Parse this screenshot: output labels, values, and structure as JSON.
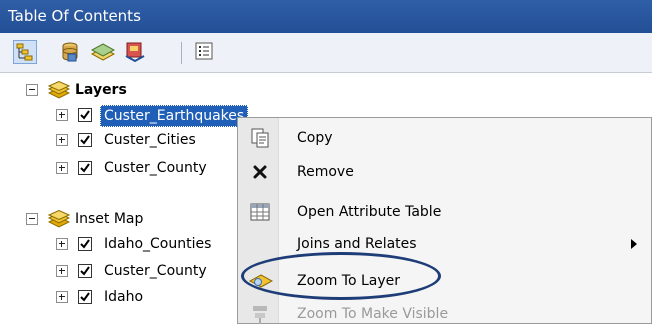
{
  "window": {
    "title": "Table Of Contents"
  },
  "toolbar": {
    "buttons": [
      {
        "icon": "list-by-drawing-order-icon"
      },
      {
        "icon": "list-by-source-icon"
      },
      {
        "icon": "list-by-visibility-icon"
      },
      {
        "icon": "list-by-selection-icon"
      },
      {
        "icon": "options-icon"
      }
    ]
  },
  "tree": {
    "frames": [
      {
        "label": "Layers",
        "expanded": true,
        "layers": [
          {
            "label": "Custer_Earthquakes",
            "checked": true,
            "selected": true
          },
          {
            "label": "Custer_Cities",
            "checked": true,
            "selected": false
          },
          {
            "label": "Custer_County",
            "checked": true,
            "selected": false
          }
        ]
      },
      {
        "label": "Inset Map",
        "expanded": true,
        "layers": [
          {
            "label": "Idaho_Counties",
            "checked": true,
            "selected": false
          },
          {
            "label": "Custer_County",
            "checked": true,
            "selected": false
          },
          {
            "label": "Idaho",
            "checked": true,
            "selected": false
          }
        ]
      }
    ]
  },
  "context_menu": {
    "items": [
      {
        "label": "Copy",
        "icon": "copy-icon",
        "enabled": true,
        "submenu": false
      },
      {
        "label": "Remove",
        "icon": "remove-x-icon",
        "enabled": true,
        "submenu": false
      },
      {
        "label": "Open Attribute Table",
        "icon": "table-icon",
        "enabled": true,
        "submenu": false
      },
      {
        "label": "Joins and Relates",
        "icon": "",
        "enabled": true,
        "submenu": true
      },
      {
        "label": "Zoom To Layer",
        "icon": "zoom-to-layer-icon",
        "enabled": true,
        "submenu": false
      },
      {
        "label": "Zoom To Make Visible",
        "icon": "zoom-to-make-visible-icon",
        "enabled": false,
        "submenu": false
      }
    ]
  },
  "annotation": {
    "highlight_item": "Zoom To Layer",
    "color": "#1e3d78"
  },
  "colors": {
    "title_bar": "#2f5fa7",
    "selection": "#1f5fb8",
    "layer_icon": "#f1c232"
  }
}
